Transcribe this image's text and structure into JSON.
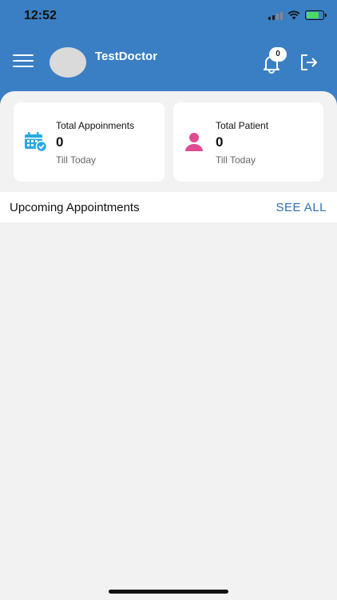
{
  "status_bar": {
    "time": "12:52"
  },
  "header": {
    "user_name": "TestDoctor",
    "notification_count": "0",
    "colors": {
      "header_bg": "#3a7fc4"
    }
  },
  "cards": [
    {
      "title": "Total Appoinments",
      "count": "0",
      "subtitle": "Till Today",
      "icon": "calendar-check-icon",
      "icon_color": "#29a8e0"
    },
    {
      "title": "Total Patient",
      "count": "0",
      "subtitle": "Till Today",
      "icon": "person-icon",
      "icon_color": "#e04a93"
    }
  ],
  "upcoming": {
    "title": "Upcoming Appointments",
    "see_all_label": "SEE ALL"
  }
}
